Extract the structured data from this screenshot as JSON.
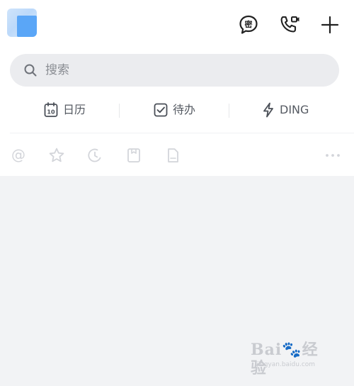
{
  "header": {
    "avatar_icon": "user-avatar",
    "actions": [
      {
        "icon": "secret-chat-icon",
        "glyph": "密"
      },
      {
        "icon": "phone-video-icon"
      },
      {
        "icon": "plus-icon"
      }
    ]
  },
  "search": {
    "placeholder": "搜索"
  },
  "quick_actions": [
    {
      "label": "日历",
      "icon": "calendar-icon",
      "badge": "10"
    },
    {
      "label": "待办",
      "icon": "todo-check-icon"
    },
    {
      "label": "DING",
      "icon": "lightning-icon"
    }
  ],
  "tools": [
    {
      "icon": "at-icon",
      "glyph": "@"
    },
    {
      "icon": "star-icon"
    },
    {
      "icon": "clock-icon"
    },
    {
      "icon": "bookmark-doc-icon"
    },
    {
      "icon": "file-icon"
    },
    {
      "icon": "more-icon",
      "glyph": "···"
    }
  ],
  "watermark": {
    "main": "Bai🐾经验",
    "sub": "jingyan.baidu.com"
  },
  "colors": {
    "background": "#f2f3f5",
    "panel": "#ffffff",
    "search_bg": "#ebecef",
    "avatar_blue": "#5aa6f7",
    "muted_icon": "#d3d5da"
  }
}
